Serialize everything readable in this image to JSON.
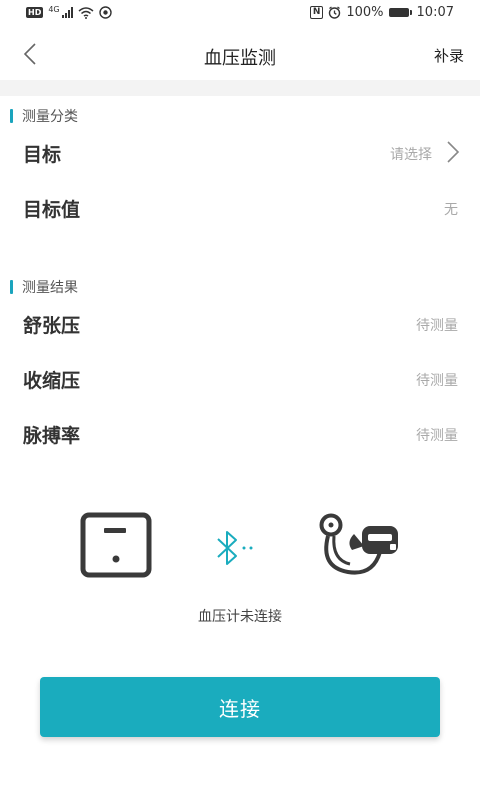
{
  "status_bar": {
    "hd": "HD",
    "network": "4G",
    "battery_pct": "100%",
    "time": "10:07",
    "nfc": "N"
  },
  "header": {
    "title": "血压监测",
    "action": "补录"
  },
  "sections": {
    "category": {
      "title": "测量分类",
      "rows": [
        {
          "label": "目标",
          "value": "请选择"
        },
        {
          "label": "目标值",
          "value": "无"
        }
      ]
    },
    "result": {
      "title": "测量结果",
      "rows": [
        {
          "label": "舒张压",
          "value": "待测量"
        },
        {
          "label": "收缩压",
          "value": "待测量"
        },
        {
          "label": "脉搏率",
          "value": "待测量"
        }
      ]
    }
  },
  "device": {
    "status": "血压计未连接"
  },
  "connect_button": {
    "label": "连接"
  },
  "colors": {
    "accent": "#1aacbe",
    "placeholder": "#a9a9a9"
  }
}
